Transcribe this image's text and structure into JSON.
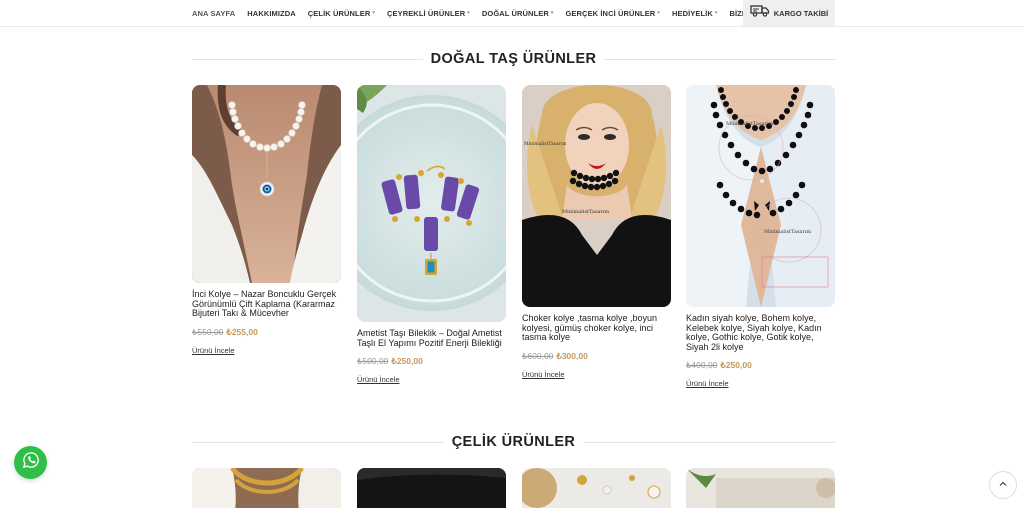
{
  "nav": {
    "items": [
      {
        "label": "ANA SAYFA",
        "has_caret": false
      },
      {
        "label": "HAKKIMIZDA",
        "has_caret": false
      },
      {
        "label": "ÇELİK ÜRÜNLER",
        "has_caret": true
      },
      {
        "label": "ÇEYREKLİ ÜRÜNLER",
        "has_caret": true
      },
      {
        "label": "DOĞAL ÜRÜNLER",
        "has_caret": true
      },
      {
        "label": "GERÇEK İNCİ ÜRÜNLER",
        "has_caret": true
      },
      {
        "label": "HEDİYELİK",
        "has_caret": true
      },
      {
        "label": "BİZE ULAŞIN",
        "has_caret": false
      }
    ],
    "cargo_label": "KARGO TAKİBİ",
    "cargo_icon": "truck-icon"
  },
  "section1": {
    "title": "DOĞAL TAŞ ÜRÜNLER",
    "products": [
      {
        "name": "İnci Kolye – Nazar Boncuklu Gerçek Görünümlü Çift Kaplama (Kararmaz Bijuteri Takı & Mücevher",
        "old_price": "₺550,00",
        "new_price": "₺255,00",
        "link": "Ürünü İncele"
      },
      {
        "name": "Ametist Taşı Bileklik – Doğal Ametist Taşlı El Yapımı Pozitif Enerji Bilekliği",
        "old_price": "₺500,00",
        "new_price": "₺250,00",
        "link": "Ürünü İncele"
      },
      {
        "name": "Choker kolye ,tasma kolye ,boyun kolyesi, gümüş choker kolye, inci tasma kolye",
        "old_price": "₺600,00",
        "new_price": "₺300,00",
        "link": "Ürünü İncele",
        "watermark": "MinimalistTasarım"
      },
      {
        "name": "Kadın siyah kolye, Bohem kolye, Kelebek kolye, Siyah kolye, Kadın kolye, Gothic kolye, Gotik kolye, Siyah 2li kolye",
        "old_price": "₺400,00",
        "new_price": "₺250,00",
        "link": "Ürünü İncele",
        "watermark": "MinimalistTasarım"
      }
    ]
  },
  "section2": {
    "title": "ÇELİK ÜRÜNLER"
  },
  "floating": {
    "whatsapp_icon": "whatsapp-icon",
    "to_top_icon": "chevron-up-icon"
  },
  "colors": {
    "price_accent": "#c49a5a",
    "whatsapp": "#2fbe47"
  }
}
